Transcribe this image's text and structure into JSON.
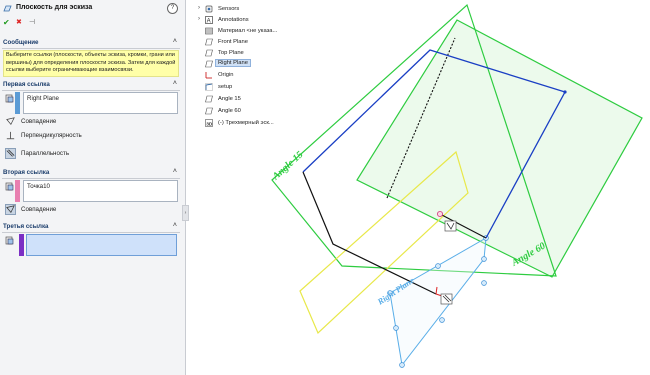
{
  "property_manager": {
    "title": "Плоскость для эскиза",
    "help_glyph": "?",
    "ok_glyph": "✔",
    "cancel_glyph": "✖",
    "pin_glyph": "⊣",
    "message_section": {
      "header": "Сообщение",
      "text": "Выберите ссылки (плоскости, объекты эскиза, кромки, грани или вершины) для определения плоскости эскиза. Затем для каждой ссылки выберите ограничивающие взаимосвязи."
    },
    "first_reference": {
      "header": "Первая ссылка",
      "value": "Right Plane",
      "color": "#5b9bd5",
      "constraints": [
        {
          "label": "Совпадение",
          "selected": false
        },
        {
          "label": "Перпендикулярность",
          "selected": false
        },
        {
          "label": "Параллельность",
          "selected": true
        }
      ]
    },
    "second_reference": {
      "header": "Вторая ссылка",
      "value": "Точка10",
      "color": "#e87fb0",
      "constraints": [
        {
          "label": "Совпадение",
          "selected": true
        }
      ]
    },
    "third_reference": {
      "header": "Третья ссылка",
      "value": "",
      "color": "#7b2fc4"
    },
    "collapse_glyph": "˄",
    "sidebar_toggle": "›"
  },
  "feature_tree": {
    "items": [
      {
        "label": "Sensors",
        "icon": "sensor-icon"
      },
      {
        "label": "Annotations",
        "icon": "annotations-icon"
      },
      {
        "label": "Материал <не указа...",
        "icon": "material-icon"
      },
      {
        "label": "Front Plane",
        "icon": "plane-icon"
      },
      {
        "label": "Top Plane",
        "icon": "plane-icon"
      },
      {
        "label": "Right Plane",
        "icon": "plane-icon",
        "selected": true
      },
      {
        "label": "Origin",
        "icon": "origin-icon"
      },
      {
        "label": "setup",
        "icon": "sketch-icon"
      },
      {
        "label": "Angle 15",
        "icon": "plane-icon"
      },
      {
        "label": "Angle 60",
        "icon": "plane-icon"
      },
      {
        "label": "(-) Трехмерный эск...",
        "icon": "3dsketch-icon"
      }
    ]
  },
  "viewport": {
    "plane_labels": {
      "angle15": "Angle 15",
      "angle60": "Angle 60",
      "right": "Right Plane"
    },
    "colors": {
      "plane_green": "#2ecc40",
      "plane_green_fill": "#d9f5d9",
      "plane_yellow": "#e8e84a",
      "plane_blue": "#5aaee8",
      "edge_blue": "#1a3fc4",
      "edge_black": "#111111"
    }
  }
}
